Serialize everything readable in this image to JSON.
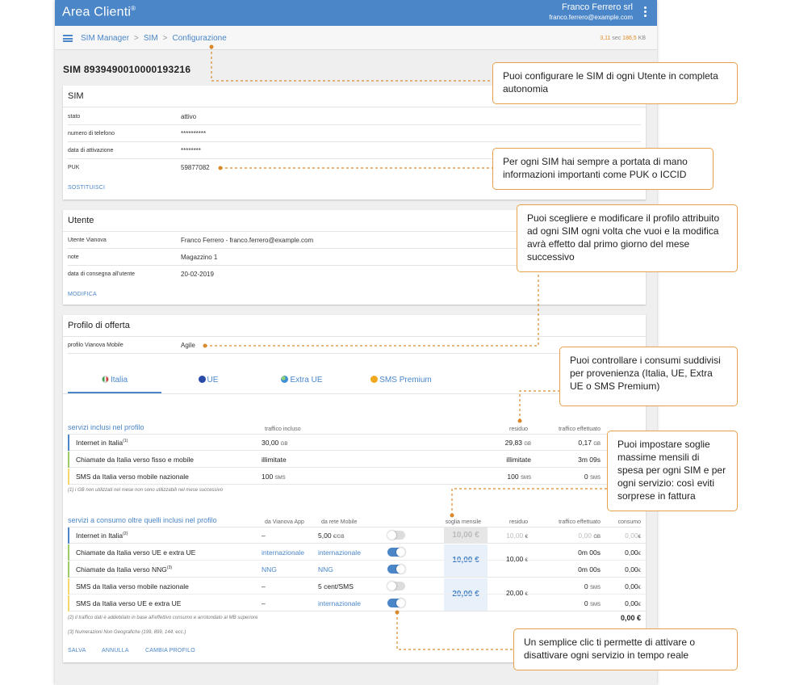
{
  "header": {
    "title": "Area Clienti",
    "title_mark": "®",
    "user_name": "Franco Ferrero srl",
    "user_email": "franco.ferrero@example.com"
  },
  "breadcrumb": [
    "SIM Manager",
    "SIM",
    "Configurazione"
  ],
  "breadcrumb_sep": ">",
  "perf": {
    "time": "3,11",
    "time_unit": "sec",
    "size": "186,5",
    "size_unit": "KB"
  },
  "sim_title": "SIM 8939490010000193216",
  "sim_card": {
    "title": "SIM",
    "rows": [
      {
        "label": "stato",
        "value": "attivo"
      },
      {
        "label": "numero di telefono",
        "value": "**********"
      },
      {
        "label": "data di attivazione",
        "value": "********"
      },
      {
        "label": "PUK",
        "value": "59877082"
      }
    ],
    "action": "SOSTITUISCI"
  },
  "user_card": {
    "title": "Utente",
    "rows": [
      {
        "label": "Utente Vianova",
        "value": "Franco Ferrero - franco.ferrero@example.com"
      },
      {
        "label": "note",
        "value": "Magazzino 1"
      },
      {
        "label": "data di consegna all'utente",
        "value": "20-02-2019"
      }
    ],
    "action": "MODIFICA"
  },
  "offer_card": {
    "title": "Profilo di offerta",
    "profile_label": "profilo Vianova Mobile",
    "profile_value": "Agile",
    "tabs": [
      {
        "label": "Italia",
        "flag_color": "#2e9b3e",
        "active": true
      },
      {
        "label": "UE",
        "flag_color": "#2a4aa8",
        "active": false
      },
      {
        "label": "Extra UE",
        "flag_color": "#3f8fd6",
        "active": false
      },
      {
        "label": "SMS Premium",
        "flag_color": "#f0a81e",
        "active": false
      }
    ],
    "included": {
      "heading": "servizi inclusi nel profilo",
      "col_traffic": "traffico incluso",
      "col_residual": "residuo",
      "col_used": "traffico effettuato",
      "rows": [
        {
          "name": "Internet in Italia",
          "sup": "(1)",
          "traffic": "30,00",
          "traffic_unit": "GB",
          "residual": "29,83",
          "residual_unit": "GB",
          "used": "0,17",
          "used_unit": "GB",
          "bar": "#4a86c8"
        },
        {
          "name": "Chiamate da Italia verso fisso e mobile",
          "sup": "",
          "traffic": "illimitate",
          "traffic_unit": "",
          "residual": "illimitate",
          "residual_unit": "",
          "used": "3m 09s",
          "used_unit": "",
          "bar": "#9ccc65"
        },
        {
          "name": "SMS da Italia verso mobile nazionale",
          "sup": "",
          "traffic": "100",
          "traffic_unit": "SMS",
          "residual": "100",
          "residual_unit": "SMS",
          "used": "0",
          "used_unit": "SMS",
          "bar": "#f5d76e"
        }
      ],
      "note": "(1) i GB non utilizzati nel mese non sono utilizzabili nel mese successivo"
    },
    "consumption": {
      "heading": "servizi a consumo oltre quelli inclusi nel profilo",
      "col_app": "da Vianova App",
      "col_mobile": "da rete Mobile",
      "col_threshold": "soglia mensile",
      "col_residual": "residuo",
      "col_used": "traffico effettuato",
      "col_cost": "consumo",
      "rows": [
        {
          "name": "Internet in Italia",
          "sup": "(2)",
          "app": "–",
          "mobile": "5,00",
          "mobile_unit": "€/GB",
          "toggle": "off",
          "used": "0,00",
          "used_unit": "GB",
          "cost": "0,00",
          "bar": "#4a86c8"
        },
        {
          "name": "Chiamate da Italia verso UE e extra UE",
          "sup": "",
          "app": "internazionale",
          "mobile": "internazionale",
          "mobile_unit": "",
          "toggle": "on",
          "used": "0m 00s",
          "used_unit": "",
          "cost": "0,00",
          "bar": "#9ccc65"
        },
        {
          "name": "Chiamate da Italia verso NNG",
          "sup": "(3)",
          "app": "NNG",
          "mobile": "NNG",
          "mobile_unit": "",
          "toggle": "on",
          "used": "0m 00s",
          "used_unit": "",
          "cost": "0,00",
          "bar": "#9ccc65"
        },
        {
          "name": "SMS da Italia verso mobile nazionale",
          "sup": "",
          "app": "–",
          "mobile": "5 cent/SMS",
          "mobile_unit": "",
          "toggle": "off",
          "used": "0",
          "used_unit": "SMS",
          "cost": "0,00",
          "bar": "#f5d76e"
        },
        {
          "name": "SMS da Italia verso UE e extra UE",
          "sup": "",
          "app": "–",
          "mobile": "internazionale",
          "mobile_unit": "",
          "toggle": "on",
          "used": "0",
          "used_unit": "SMS",
          "cost": "0,00",
          "bar": "#f5d76e"
        }
      ],
      "thresholds": [
        {
          "value": "10,00 €",
          "residual": "10,00",
          "disabled": true
        },
        {
          "value": "10,00 €",
          "residual": "10,00",
          "disabled": false
        },
        {
          "value": "20,00 €",
          "residual": "20,00",
          "disabled": false
        }
      ],
      "euro": "€",
      "total": "0,00 €",
      "notes": [
        "(2) il traffico dati è addebitato in base all'effettivo consumo e arrotondato al MB superiore",
        "(3) Numerazioni Non Geografiche (199, 899, 144, ecc.)"
      ]
    },
    "actions": [
      "SALVA",
      "ANNULLA",
      "CAMBIA PROFILO"
    ]
  },
  "callouts": [
    "Puoi configurare le SIM di ogni Utente in completa autonomia",
    "Per ogni SIM hai sempre a portata di mano informazioni importanti come PUK o ICCID",
    "Puoi scegliere e modificare il profilo attribuito ad ogni SIM ogni volta che vuoi e la modifica avrà effetto dal primo giorno del mese successivo",
    "Puoi controllare i consumi suddivisi per provenienza (Italia, UE, Extra UE o SMS Premium)",
    "Puoi impostare soglie massime mensili di spesa per ogni SIM e per ogni servizio: così eviti sorprese in fattura",
    "Un semplice clic ti permette di attivare o disattivare ogni servizio in tempo reale"
  ],
  "colors": {
    "accent": "#4a86c8",
    "callout_border": "#e7a04a",
    "connector": "#d9892b"
  }
}
